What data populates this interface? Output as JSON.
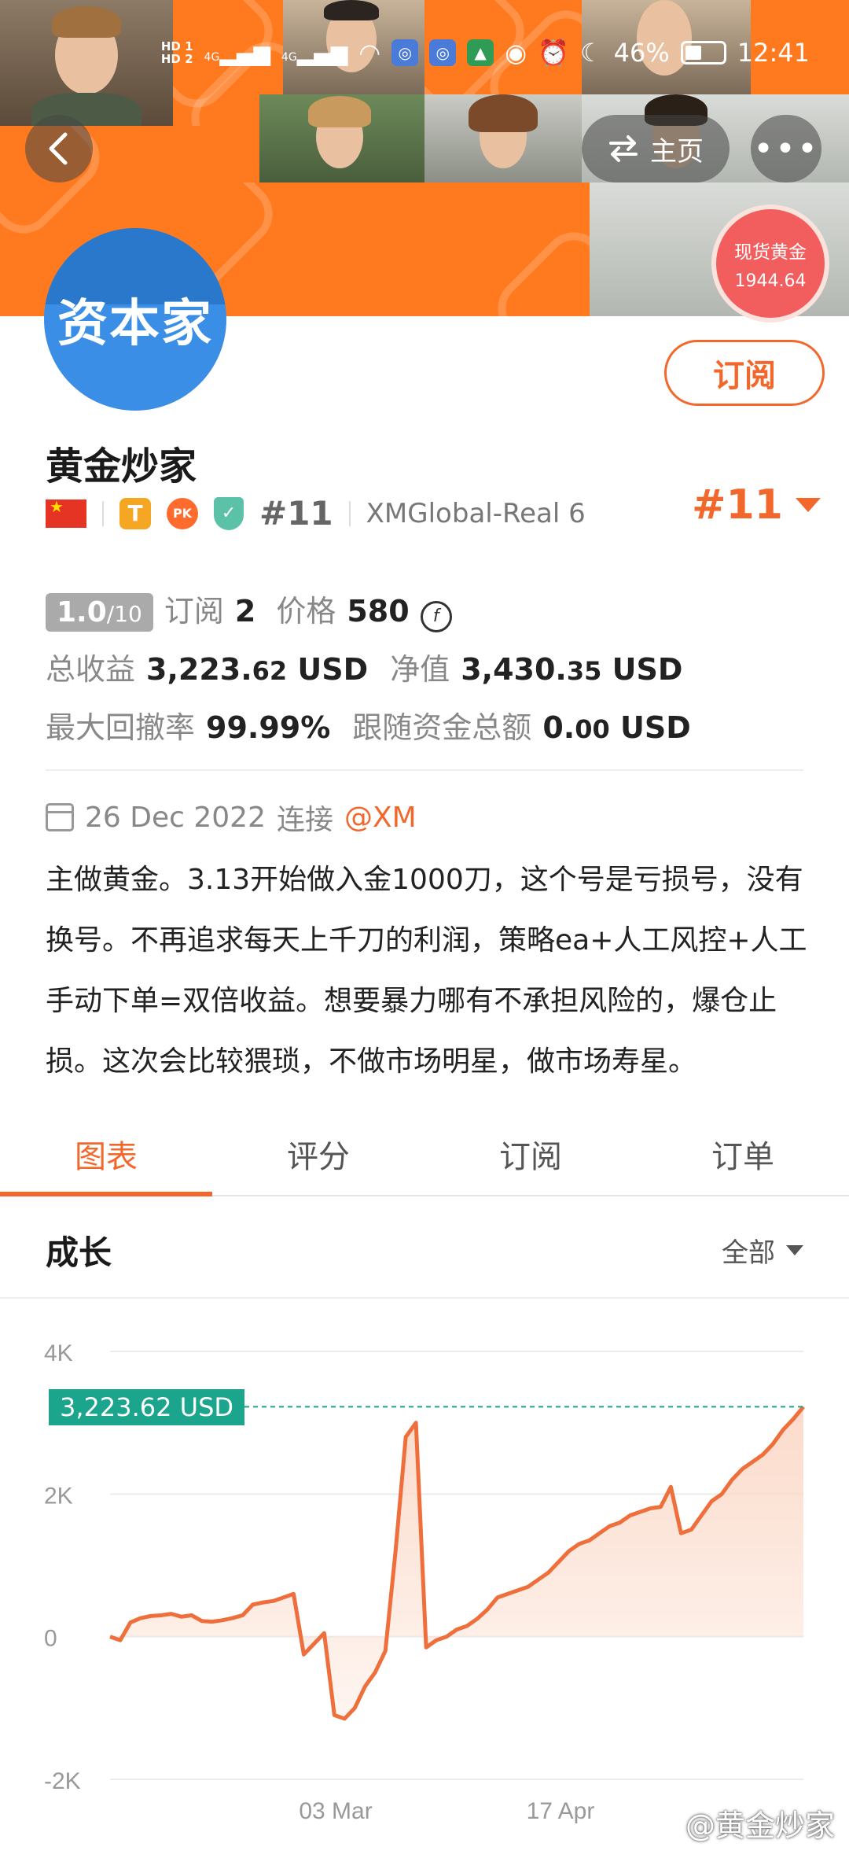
{
  "status_bar": {
    "sim1": "HD 1",
    "sim2": "HD 2",
    "net1": "4G",
    "net2": "4G",
    "battery": "46%",
    "time": "12:41"
  },
  "header": {
    "back_icon": "chevron-left-icon",
    "home_label": "主页",
    "home_icon": "switch-arrows-icon",
    "more_icon": "more-dots-icon",
    "more_label": "•••"
  },
  "gold_badge": {
    "label": "现货黄金",
    "price": "1944.64"
  },
  "profile": {
    "avatar_text": "资本家",
    "name": "黄金炒家",
    "subscribe_label": "订阅",
    "t_badge": "T",
    "pk_badge": "PK",
    "shield_mark": "✓",
    "rank_small": "#11",
    "server": "XMGlobal-Real 6",
    "rank_big": "#11"
  },
  "stats": {
    "rating_value": "1.0",
    "rating_max": "/10",
    "subscribe_label": "订阅",
    "subscribe_count": "2",
    "price_label": "价格",
    "price_value": "580",
    "coin_symbol": "f",
    "total_profit_label": "总收益",
    "total_profit_main": "3,223.",
    "total_profit_decimal": "62",
    "total_profit_unit": "USD",
    "equity_label": "净值",
    "equity_main": "3,430.",
    "equity_decimal": "35",
    "equity_unit": "USD",
    "drawdown_label": "最大回撤率",
    "drawdown_value": "99.99%",
    "follow_label": "跟随资金总额",
    "follow_main": "0.",
    "follow_decimal": "00",
    "follow_unit": "USD"
  },
  "connection": {
    "date": "26 Dec 2022",
    "connect_label": "连接",
    "broker": "@XM"
  },
  "description": "主做黄金。3.13开始做入金1000刀，这个号是亏损号，没有换号。不再追求每天上千刀的利润，策略ea+人工风控+人工手动下单=双倍收益。想要暴力哪有不承担风险的，爆仓止损。这次会比较猥琐，不做市场明星，做市场寿星。",
  "tabs": [
    {
      "label": "图表",
      "active": true
    },
    {
      "label": "评分",
      "active": false
    },
    {
      "label": "订阅",
      "active": false
    },
    {
      "label": "订单",
      "active": false
    }
  ],
  "section": {
    "title": "成长",
    "filter_label": "全部"
  },
  "chart_data": {
    "type": "area",
    "ylim": [
      -2000,
      4000
    ],
    "y_ticks": [
      "4K",
      "2K",
      "0",
      "-2K"
    ],
    "y_tick_values": [
      4000,
      2000,
      0,
      -2000
    ],
    "x_ticks": [
      "03 Mar",
      "17 Apr"
    ],
    "current_value_label": "3,223.62 USD",
    "current_value": 3223.62,
    "colors": {
      "line": "#ef6f3c",
      "fill": "#fbd9c8",
      "ref_line": "#1aa58c"
    },
    "series": [
      {
        "values": [
          0,
          -50,
          200,
          260,
          290,
          300,
          320,
          280,
          300,
          220,
          210,
          230,
          260,
          300,
          450,
          480,
          500,
          550,
          600,
          -250,
          -100,
          50,
          -1100,
          -1150,
          -1000,
          -700,
          -500,
          -200,
          1200,
          2800,
          3000,
          -150,
          -50,
          0,
          100,
          150,
          250,
          380,
          550,
          600,
          650,
          700,
          800,
          900,
          1050,
          1200,
          1300,
          1350,
          1450,
          1550,
          1600,
          1700,
          1750,
          1800,
          1820,
          2100,
          1450,
          1500,
          1700,
          1900,
          2000,
          2200,
          2350,
          2450,
          2550,
          2700,
          2900,
          3050,
          3223.62
        ]
      }
    ]
  },
  "watermark": "@黄金炒家"
}
